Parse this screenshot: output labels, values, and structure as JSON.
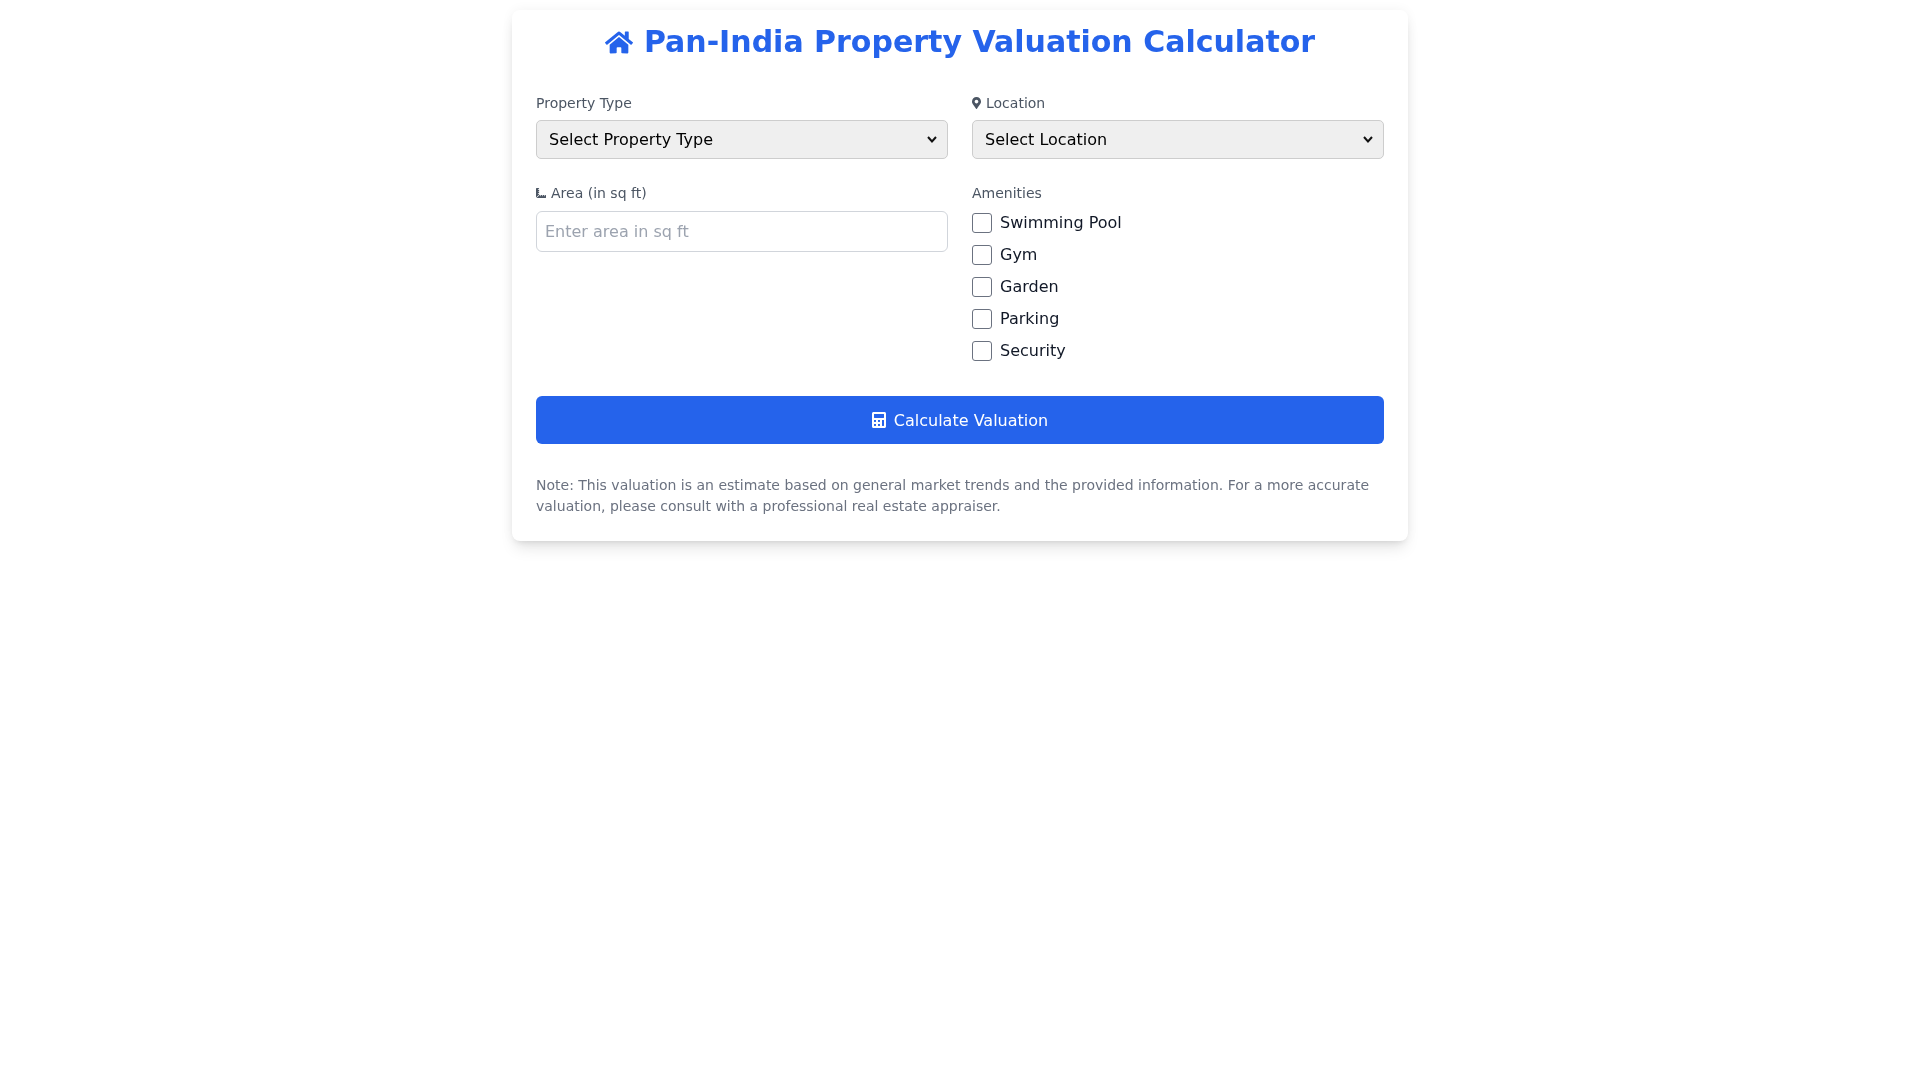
{
  "title": "Pan-India Property Valuation Calculator",
  "property_type": {
    "label": "Property Type",
    "value": "Select Property Type"
  },
  "location": {
    "label": "Location",
    "value": "Select Location"
  },
  "area": {
    "label": "Area (in sq ft)",
    "placeholder": "Enter area in sq ft"
  },
  "amenities": {
    "label": "Amenities",
    "items": [
      {
        "label": "Swimming Pool",
        "checked": false
      },
      {
        "label": "Gym",
        "checked": false
      },
      {
        "label": "Garden",
        "checked": false
      },
      {
        "label": "Parking",
        "checked": false
      },
      {
        "label": "Security",
        "checked": false
      }
    ]
  },
  "calculate_button": {
    "label": "Calculate Valuation"
  },
  "note": "Note: This valuation is an estimate based on general market trends and the provided information. For a more accurate valuation, please consult with a professional real estate appraiser."
}
